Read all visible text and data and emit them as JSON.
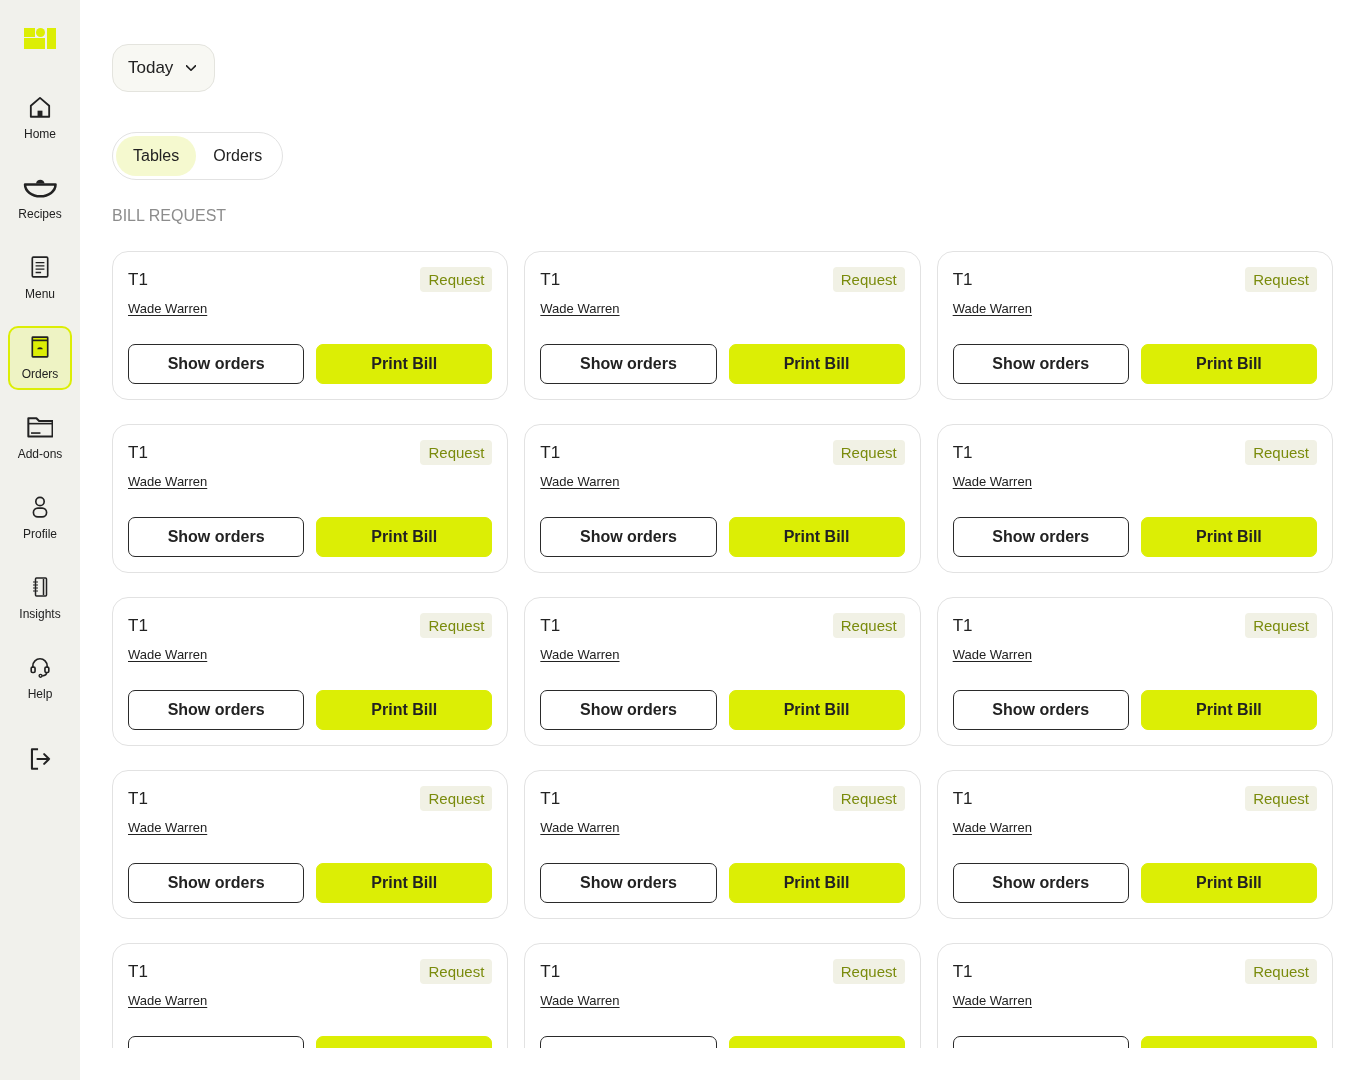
{
  "sidebar": {
    "nav": [
      {
        "label": "Home",
        "selected": false
      },
      {
        "label": "Recipes",
        "selected": false
      },
      {
        "label": "Menu",
        "selected": false
      },
      {
        "label": "Orders",
        "selected": true
      },
      {
        "label": "Add-ons",
        "selected": false
      },
      {
        "label": "Profile",
        "selected": false
      },
      {
        "label": "Insights",
        "selected": false
      },
      {
        "label": "Help",
        "selected": false
      }
    ]
  },
  "filter": {
    "value": "Today"
  },
  "view_tabs": [
    {
      "label": "Tables",
      "selected": true
    },
    {
      "label": "Orders",
      "selected": false
    }
  ],
  "section_title": "BILL REQUEST",
  "cards": [
    {
      "table": "T1",
      "status": "Request",
      "customer": "Wade Warren",
      "actions": [
        {
          "label": "Show orders",
          "kind": "outline"
        },
        {
          "label": "Print Bill",
          "kind": "primary"
        }
      ]
    },
    {
      "table": "T1",
      "status": "Request",
      "customer": "Wade Warren",
      "actions": [
        {
          "label": "Show orders",
          "kind": "outline"
        },
        {
          "label": "Print Bill",
          "kind": "primary"
        }
      ]
    },
    {
      "table": "T1",
      "status": "Request",
      "customer": "Wade Warren",
      "actions": [
        {
          "label": "Show orders",
          "kind": "outline"
        },
        {
          "label": "Print Bill",
          "kind": "primary"
        }
      ]
    },
    {
      "table": "T1",
      "status": "Request",
      "customer": "Wade Warren",
      "actions": [
        {
          "label": "Show orders",
          "kind": "outline"
        },
        {
          "label": "Print Bill",
          "kind": "primary"
        }
      ]
    },
    {
      "table": "T1",
      "status": "Request",
      "customer": "Wade Warren",
      "actions": [
        {
          "label": "Show orders",
          "kind": "outline"
        },
        {
          "label": "Print Bill",
          "kind": "primary"
        }
      ]
    },
    {
      "table": "T1",
      "status": "Request",
      "customer": "Wade Warren",
      "actions": [
        {
          "label": "Show orders",
          "kind": "outline"
        },
        {
          "label": "Print Bill",
          "kind": "primary"
        }
      ]
    },
    {
      "table": "T1",
      "status": "Request",
      "customer": "Wade Warren",
      "actions": [
        {
          "label": "Show orders",
          "kind": "outline"
        },
        {
          "label": "Print Bill",
          "kind": "primary"
        }
      ]
    },
    {
      "table": "T1",
      "status": "Request",
      "customer": "Wade Warren",
      "actions": [
        {
          "label": "Show orders",
          "kind": "outline"
        },
        {
          "label": "Print Bill",
          "kind": "primary"
        }
      ]
    },
    {
      "table": "T1",
      "status": "Request",
      "customer": "Wade Warren",
      "actions": [
        {
          "label": "Show orders",
          "kind": "outline"
        },
        {
          "label": "Print Bill",
          "kind": "primary"
        }
      ]
    },
    {
      "table": "T1",
      "status": "Request",
      "customer": "Wade Warren",
      "actions": [
        {
          "label": "Show orders",
          "kind": "outline"
        },
        {
          "label": "Print Bill",
          "kind": "primary"
        }
      ]
    },
    {
      "table": "T1",
      "status": "Request",
      "customer": "Wade Warren",
      "actions": [
        {
          "label": "Show orders",
          "kind": "outline"
        },
        {
          "label": "Print Bill",
          "kind": "primary"
        }
      ]
    },
    {
      "table": "T1",
      "status": "Request",
      "customer": "Wade Warren",
      "actions": [
        {
          "label": "Show orders",
          "kind": "outline"
        },
        {
          "label": "Print Bill",
          "kind": "primary"
        }
      ]
    },
    {
      "table": "T1",
      "status": "Request",
      "customer": "Wade Warren",
      "actions": [
        {
          "kind": "outline"
        },
        {
          "kind": "primary"
        }
      ]
    },
    {
      "table": "T1",
      "status": "Request",
      "customer": "Wade Warren",
      "actions": [
        {
          "kind": "outline"
        },
        {
          "kind": "primary"
        }
      ]
    },
    {
      "table": "T1",
      "status": "Request",
      "customer": "Wade Warren",
      "actions": [
        {
          "kind": "outline"
        },
        {
          "kind": "primary"
        }
      ]
    }
  ]
}
